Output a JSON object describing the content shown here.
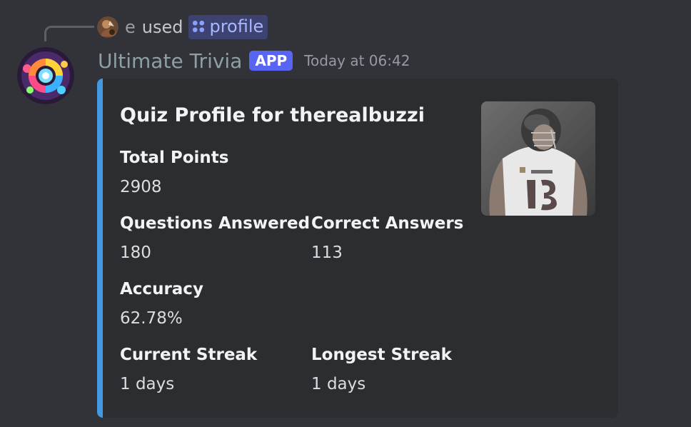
{
  "reply": {
    "user": "e",
    "used_text": "used",
    "command": "profile"
  },
  "message": {
    "author": "Ultimate Trivia",
    "tag": "APP",
    "timestamp": "Today at 06:42"
  },
  "embed": {
    "accent_color": "#4299e1",
    "title": "Quiz Profile for therealbuzzi",
    "fields": {
      "total_points": {
        "name": "Total Points",
        "value": "2908"
      },
      "questions_answered": {
        "name": "Questions Answered",
        "value": "180"
      },
      "correct_answers": {
        "name": "Correct Answers",
        "value": "113"
      },
      "accuracy": {
        "name": "Accuracy",
        "value": "62.78%"
      },
      "current_streak": {
        "name": "Current Streak",
        "value": "1 days"
      },
      "longest_streak": {
        "name": "Longest Streak",
        "value": "1 days"
      }
    }
  },
  "icons": {
    "command": "slash-command-icon",
    "bot_avatar": "trivia-wheel-avatar",
    "user_avatar": "user-avatar",
    "thumbnail": "player-photo"
  },
  "colors": {
    "background": "#323339",
    "embed_background": "#2b2d31",
    "app_tag": "#5865f2",
    "command_chip": "#3d4270"
  }
}
